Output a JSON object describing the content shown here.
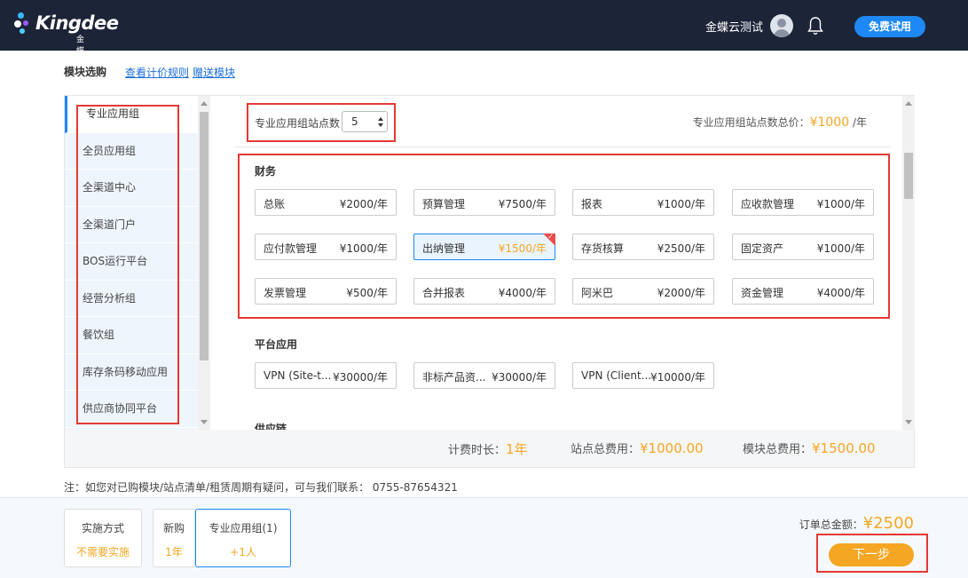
{
  "header": {
    "logo_text": "Kingdee",
    "logo_sub": "金蝶云",
    "user_name": "金蝶云测试",
    "trial_button": "免费试用"
  },
  "page": {
    "heading": "模块选购",
    "link_pricing": "查看计价规则",
    "link_gift": "赠送模块"
  },
  "sidebar": {
    "items": [
      {
        "label": "专业应用组",
        "active": true
      },
      {
        "label": "全员应用组"
      },
      {
        "label": "全渠道中心"
      },
      {
        "label": "全渠道门户"
      },
      {
        "label": "BOS运行平台"
      },
      {
        "label": "经营分析组"
      },
      {
        "label": "餐饮组"
      },
      {
        "label": "库存条码移动应用"
      },
      {
        "label": "供应商协同平台"
      }
    ]
  },
  "content": {
    "site_label": "专业应用组站点数",
    "site_value": "5",
    "site_total_label": "专业应用组站点数总价：",
    "site_total_price": "¥1000",
    "site_total_unit": " /年",
    "sections": [
      {
        "title": "财务",
        "modules": [
          {
            "name": "总账",
            "price": "¥2000/年"
          },
          {
            "name": "预算管理",
            "price": "¥7500/年"
          },
          {
            "name": "报表",
            "price": "¥1000/年"
          },
          {
            "name": "应收款管理",
            "price": "¥1000/年"
          },
          {
            "name": "应付款管理",
            "price": "¥1000/年"
          },
          {
            "name": "出纳管理",
            "price": "¥1500/年",
            "selected": true
          },
          {
            "name": "存货核算",
            "price": "¥2500/年"
          },
          {
            "name": "固定资产",
            "price": "¥1000/年"
          },
          {
            "name": "发票管理",
            "price": "¥500/年"
          },
          {
            "name": "合并报表",
            "price": "¥4000/年"
          },
          {
            "name": "阿米巴",
            "price": "¥2000/年"
          },
          {
            "name": "资金管理",
            "price": "¥4000/年"
          }
        ]
      },
      {
        "title": "平台应用",
        "modules": [
          {
            "name": "VPN (Site-t...",
            "price": "¥30000/年"
          },
          {
            "name": "非标产品资...",
            "price": "¥30000/年"
          },
          {
            "name": "VPN (Client...",
            "price": "¥10000/年"
          }
        ]
      },
      {
        "title": "供应链",
        "modules": []
      }
    ]
  },
  "summary": {
    "duration_label": "计费时长：",
    "duration_value": "1年",
    "site_fee_label": "站点总费用：",
    "site_fee_value": "¥1000.00",
    "module_fee_label": "模块总费用：",
    "module_fee_value": "¥1500.00"
  },
  "note": "注：如您对已购模块/站点清单/租赁周期有疑问，可与我们联系： 0755-87654321",
  "order": {
    "boxes": [
      {
        "title": "实施方式",
        "value": "不需要实施"
      },
      {
        "title": "新购",
        "value": "1年"
      },
      {
        "title": "专业应用组(1)",
        "value": "+1人",
        "active": true
      }
    ],
    "total_label": "订单总金额：",
    "total_value": "¥2500",
    "next_button": "下一步"
  },
  "colors": {
    "header_bg": "#1c2538",
    "accent_blue": "#1e88f5",
    "accent_orange": "#f5a623",
    "annotation_red": "#e53935"
  }
}
